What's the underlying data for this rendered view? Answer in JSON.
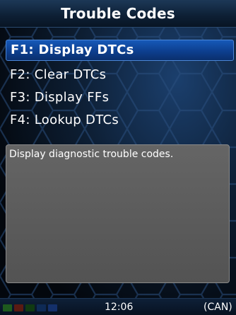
{
  "title": "Trouble Codes",
  "menu": {
    "items": [
      {
        "label": "F1: Display DTCs",
        "selected": true
      },
      {
        "label": "F2: Clear DTCs",
        "selected": false
      },
      {
        "label": "F3: Display FFs",
        "selected": false
      },
      {
        "label": "F4: Lookup DTCs",
        "selected": false
      }
    ]
  },
  "description": "Display diagnostic trouble codes.",
  "status": {
    "time": "12:06",
    "protocol": "(CAN)",
    "indicator_colors": [
      "#1e5a1e",
      "#5a1a12",
      "#103a12",
      "#0e2a55",
      "#14306a"
    ]
  },
  "colors": {
    "selection": "#0d3f8f",
    "panel": "#5d5d5d",
    "title_bar": "#0d1f34"
  }
}
